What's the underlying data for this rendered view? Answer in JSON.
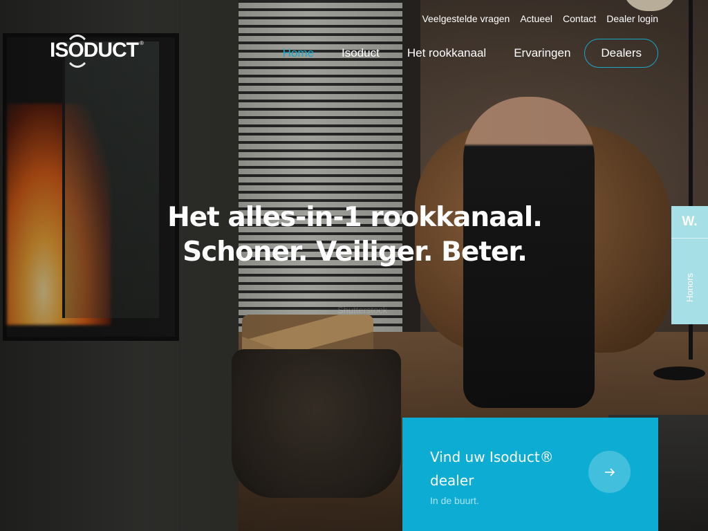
{
  "brand": {
    "logo_text": "ISODUCT",
    "logo_mark": "®"
  },
  "topnav": {
    "items": [
      {
        "label": "Veelgestelde vragen"
      },
      {
        "label": "Actueel"
      },
      {
        "label": "Contact"
      },
      {
        "label": "Dealer login"
      }
    ]
  },
  "mainnav": {
    "items": [
      {
        "label": "Home",
        "active": true
      },
      {
        "label": "Isoduct"
      },
      {
        "label": "Het rookkanaal"
      },
      {
        "label": "Ervaringen"
      }
    ],
    "cta_label": "Dealers"
  },
  "hero": {
    "line1": "Het alles-in-1 rookkanaal.",
    "line2": "Schoner. Veiliger. Beter."
  },
  "side_tab": {
    "badge": "W.",
    "label": "Honors"
  },
  "cta": {
    "title": "Vind uw Isoduct® dealer",
    "subtitle": "In de buurt.",
    "arrow_icon": "arrow-right-icon"
  },
  "watermark": "Shutterstock",
  "colors": {
    "accent": "#19a9c9",
    "cta_bg": "#0dadd3",
    "side_tab_bg": "#a7dfe6"
  }
}
